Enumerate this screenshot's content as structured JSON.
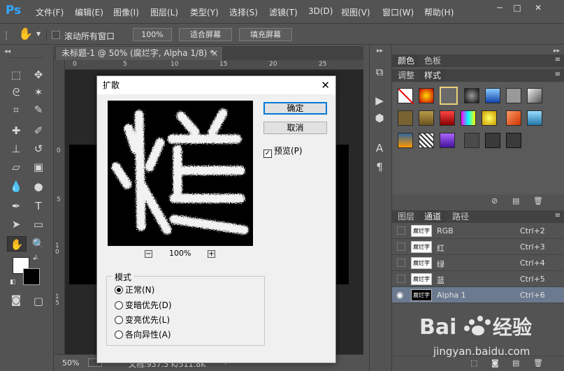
{
  "app": {
    "logo": "Ps",
    "menu": [
      "文件(F)",
      "编辑(E)",
      "图像(I)",
      "图层(L)",
      "类型(Y)",
      "选择(S)",
      "滤镜(T)",
      "3D(D)",
      "视图(V)",
      "窗口(W)",
      "帮助(H)"
    ],
    "window_controls": [
      "─",
      "□",
      "✕"
    ]
  },
  "options_bar": {
    "scroll_all_label": "滚动所有窗口",
    "scroll_all_checked": false,
    "zoom_100_label": "100%",
    "fit_screen_label": "适合屏幕",
    "fill_screen_label": "填充屏幕"
  },
  "document": {
    "tab_title": "未标题-1 @ 50% (腐烂字, Alpha 1/8) *",
    "tab_close": "×",
    "ruler_top_ticks": [
      "0",
      "5",
      "10",
      "15",
      "20",
      "25"
    ],
    "ruler_left_ticks": [
      "0",
      "5",
      "1 0",
      "1 5"
    ],
    "status_zoom": "50%",
    "status_doc": "文档:937.5 K/511.8K"
  },
  "panels": {
    "color_tabs": [
      "颜色",
      "色板"
    ],
    "style_tabs": [
      "调整",
      "样式"
    ],
    "channel_tabs": [
      "图层",
      "通道",
      "路径"
    ],
    "channels": [
      {
        "name": "RGB",
        "shortcut": "Ctrl+2",
        "thumb_text": "腐烂字",
        "selected": false
      },
      {
        "name": "红",
        "shortcut": "Ctrl+3",
        "thumb_text": "腐烂字",
        "selected": false
      },
      {
        "name": "绿",
        "shortcut": "Ctrl+4",
        "thumb_text": "腐烂字",
        "selected": false
      },
      {
        "name": "蓝",
        "shortcut": "Ctrl+5",
        "thumb_text": "腐烂字",
        "selected": false
      },
      {
        "name": "Alpha 1",
        "shortcut": "Ctrl+6",
        "thumb_text": "腐烂字",
        "selected": true
      }
    ]
  },
  "dialog": {
    "title": "扩散",
    "close_glyph": "✕",
    "ok_label": "确定",
    "cancel_label": "取消",
    "preview_label": "预览(P)",
    "preview_checked": true,
    "preview_zoom": "100%",
    "zoom_out_glyph": "−",
    "zoom_in_glyph": "+",
    "mode_legend": "模式",
    "modes": [
      "正常(N)",
      "变暗优先(D)",
      "变亮优先(L)",
      "各向异性(A)"
    ],
    "selected_mode": 0
  },
  "colors": {
    "ps_blue": "#31a8ff",
    "panel_bg": "#535353",
    "selected_row": "#6b7a8f",
    "dialog_bg": "#f0f0f0"
  }
}
